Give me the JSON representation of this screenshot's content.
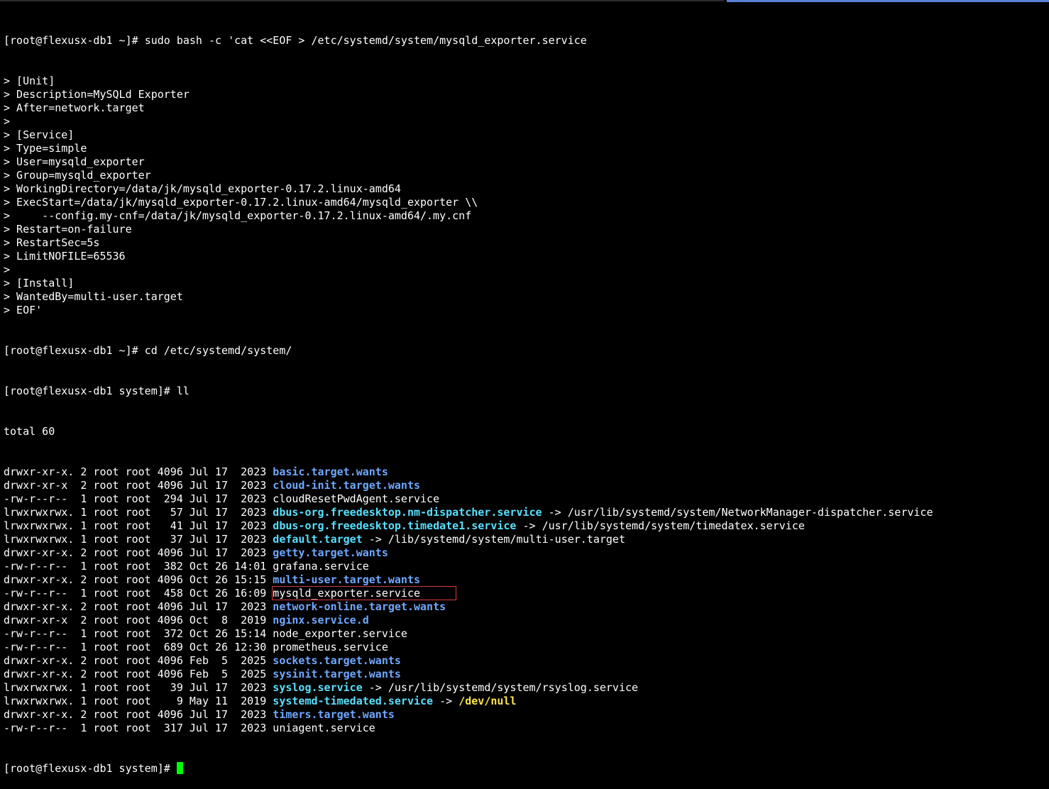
{
  "terminal": {
    "prompt_home": "[root@flexusx-db1 ~]# ",
    "prompt_system": "[root@flexusx-db1 system]# ",
    "heredoc_command": "sudo bash -c 'cat <<EOF > /etc/systemd/system/mysqld_exporter.service",
    "heredoc_lines": [
      "> [Unit]",
      "> Description=MySQLd Exporter",
      "> After=network.target",
      ">",
      "> [Service]",
      "> Type=simple",
      "> User=mysqld_exporter",
      "> Group=mysqld_exporter",
      "> WorkingDirectory=/data/jk/mysqld_exporter-0.17.2.linux-amd64",
      "> ExecStart=/data/jk/mysqld_exporter-0.17.2.linux-amd64/mysqld_exporter \\\\",
      ">     --config.my-cnf=/data/jk/mysqld_exporter-0.17.2.linux-amd64/.my.cnf",
      "> Restart=on-failure",
      "> RestartSec=5s",
      "> LimitNOFILE=65536",
      ">",
      "> [Install]",
      "> WantedBy=multi-user.target",
      "> EOF'"
    ],
    "cd_command": "cd /etc/systemd/system/",
    "ll_command": "ll",
    "total_line": "total 60",
    "listing": [
      {
        "meta": "drwxr-xr-x. 2 root root 4096 Jul 17  2023 ",
        "name": "basic.target.wants",
        "kind": "dir"
      },
      {
        "meta": "drwxr-xr-x  2 root root 4096 Jul 17  2023 ",
        "name": "cloud-init.target.wants",
        "kind": "dir"
      },
      {
        "meta": "-rw-r--r--  1 root root  294 Jul 17  2023 ",
        "name": "cloudResetPwdAgent.service",
        "kind": "file"
      },
      {
        "meta": "lrwxrwxrwx. 1 root root   57 Jul 17  2023 ",
        "name": "dbus-org.freedesktop.nm-dispatcher.service",
        "kind": "link",
        "arrow": " -> ",
        "target": "/usr/lib/systemd/system/NetworkManager-dispatcher.service"
      },
      {
        "meta": "lrwxrwxrwx. 1 root root   41 Jul 17  2023 ",
        "name": "dbus-org.freedesktop.timedate1.service",
        "kind": "link",
        "arrow": " -> ",
        "target": "/usr/lib/systemd/system/timedatex.service"
      },
      {
        "meta": "lrwxrwxrwx. 1 root root   37 Jul 17  2023 ",
        "name": "default.target",
        "kind": "link",
        "arrow": " -> ",
        "target": "/lib/systemd/system/multi-user.target"
      },
      {
        "meta": "drwxr-xr-x. 2 root root 4096 Jul 17  2023 ",
        "name": "getty.target.wants",
        "kind": "dir"
      },
      {
        "meta": "-rw-r--r--  1 root root  382 Oct 26 14:01 ",
        "name": "grafana.service",
        "kind": "file"
      },
      {
        "meta": "drwxr-xr-x. 2 root root 4096 Oct 26 15:15 ",
        "name": "multi-user.target.wants",
        "kind": "dir"
      },
      {
        "meta": "-rw-r--r--  1 root root  458 Oct 26 16:09 ",
        "name": "mysqld_exporter.service",
        "kind": "file",
        "highlighted": true
      },
      {
        "meta": "drwxr-xr-x. 2 root root 4096 Jul 17  2023 ",
        "name": "network-online.target.wants",
        "kind": "dir"
      },
      {
        "meta": "drwxr-xr-x  2 root root 4096 Oct  8  2019 ",
        "name": "nginx.service.d",
        "kind": "dir"
      },
      {
        "meta": "-rw-r--r--  1 root root  372 Oct 26 15:14 ",
        "name": "node_exporter.service",
        "kind": "file"
      },
      {
        "meta": "-rw-r--r--  1 root root  689 Oct 26 12:30 ",
        "name": "prometheus.service",
        "kind": "file"
      },
      {
        "meta": "drwxr-xr-x. 2 root root 4096 Feb  5  2025 ",
        "name": "sockets.target.wants",
        "kind": "dir"
      },
      {
        "meta": "drwxr-xr-x. 2 root root 4096 Feb  5  2025 ",
        "name": "sysinit.target.wants",
        "kind": "dir"
      },
      {
        "meta": "lrwxrwxrwx. 1 root root   39 Jul 17  2023 ",
        "name": "syslog.service",
        "kind": "link",
        "arrow": " -> ",
        "target": "/usr/lib/systemd/system/rsyslog.service"
      },
      {
        "meta": "lrwxrwxrwx. 1 root root    9 May 11  2019 ",
        "name": "systemd-timedated.service",
        "kind": "link",
        "arrow": " -> ",
        "target": "/dev/null",
        "target_kind": "dev"
      },
      {
        "meta": "drwxr-xr-x. 2 root root 4096 Jul 17  2023 ",
        "name": "timers.target.wants",
        "kind": "dir"
      },
      {
        "meta": "-rw-r--r--  1 root root  317 Jul 17  2023 ",
        "name": "uniagent.service",
        "kind": "file"
      }
    ],
    "colors": {
      "background": "#000000",
      "text": "#ffffff",
      "directory": "#6fa8ff",
      "symlink": "#58e0ff",
      "device_target": "#ffe44c",
      "cursor": "#00ff00",
      "highlight_box": "#d83b3b"
    }
  }
}
